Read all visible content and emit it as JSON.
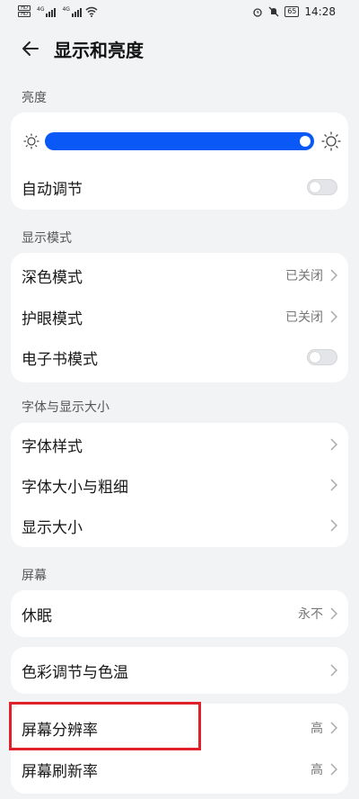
{
  "status": {
    "time": "14:28",
    "battery": "65",
    "sim1": "HD",
    "sim2": "HD",
    "net1": "4G",
    "net2": "4G"
  },
  "header": {
    "title": "显示和亮度"
  },
  "brightness": {
    "section_label": "亮度",
    "level": 1.0,
    "auto_label": "自动调节",
    "auto_on": false
  },
  "display_mode": {
    "section_label": "显示模式",
    "dark_label": "深色模式",
    "dark_value": "已关闭",
    "eye_label": "护眼模式",
    "eye_value": "已关闭",
    "ebook_label": "电子书模式",
    "ebook_on": false
  },
  "font": {
    "section_label": "字体与显示大小",
    "style_label": "字体样式",
    "size_label": "字体大小与粗细",
    "display_size_label": "显示大小"
  },
  "screen": {
    "section_label": "屏幕",
    "sleep_label": "休眠",
    "sleep_value": "永不",
    "color_label": "色彩调节与色温",
    "resolution_label": "屏幕分辨率",
    "resolution_value": "高",
    "refresh_label": "屏幕刷新率",
    "refresh_value": "高"
  },
  "colors": {
    "accent": "#0a59f7",
    "highlight": "#e0202a"
  }
}
